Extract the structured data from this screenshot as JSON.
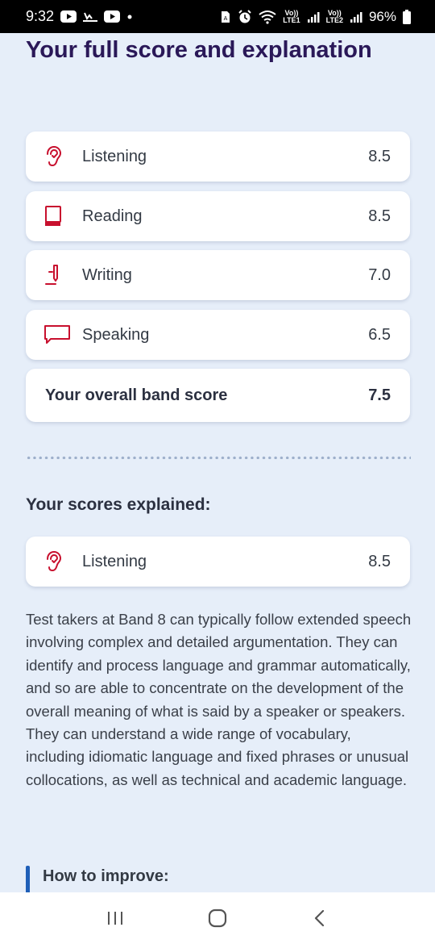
{
  "status_bar": {
    "time": "9:32",
    "battery_pct": "96%",
    "net1_top": "Vo))",
    "net1_bottom": "LTE1",
    "net2_top": "Vo))",
    "net2_bottom": "LTE2",
    "icons": [
      "youtube-icon",
      "cast-icon",
      "youtube-icon",
      "dot-icon",
      "sim-icon",
      "alarm-icon",
      "wifi-icon",
      "signal-icon",
      "signal-icon",
      "battery-icon"
    ]
  },
  "page": {
    "title": "Your full score and explanation"
  },
  "scores": [
    {
      "label": "Listening",
      "score": "8.5",
      "icon": "ear-icon"
    },
    {
      "label": "Reading",
      "score": "8.5",
      "icon": "book-icon"
    },
    {
      "label": "Writing",
      "score": "7.0",
      "icon": "pen-icon"
    },
    {
      "label": "Speaking",
      "score": "6.5",
      "icon": "speech-bubble-icon"
    }
  ],
  "overall": {
    "label": "Your overall band score",
    "score": "7.5"
  },
  "explained": {
    "heading": "Your scores explained:",
    "card": {
      "label": "Listening",
      "score": "8.5",
      "icon": "ear-icon"
    },
    "text": "Test takers at Band 8 can typically follow extended speech involving complex and detailed argumentation. They can identify and process language and grammar automatically, and so are able to concentrate on the development of the overall meaning of what is said by a speaker or speakers. They can understand a wide range of vocabulary, including idiomatic language and fixed phrases or unusual collocations, as well as technical and academic language."
  },
  "improve": {
    "heading": "How to improve:"
  },
  "colors": {
    "accent": "#c8102e",
    "title": "#2a1858",
    "background": "#e6eef9",
    "improve_bar": "#1f5fb8"
  }
}
